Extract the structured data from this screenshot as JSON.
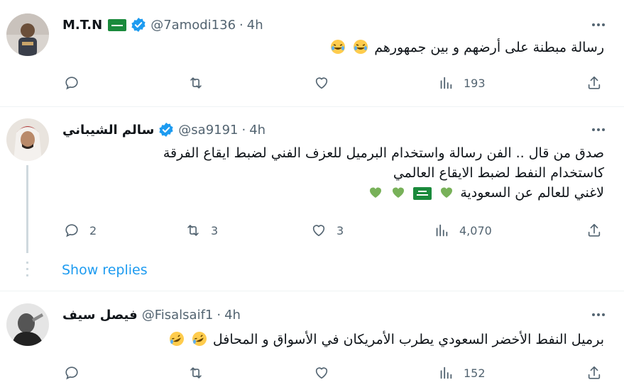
{
  "tweets": [
    {
      "name": "M.T.N",
      "handle": "@7amodi136",
      "separator": "·",
      "time": "4h",
      "lines": [
        "رسالة مبطنة على أرضهم و بين جمهورهم"
      ],
      "emoji": "laughing-crying",
      "counts": {
        "reply": "",
        "retweet": "",
        "like": "",
        "views": "193"
      }
    },
    {
      "name": "سالم الشيباني",
      "handle": "@sa9191",
      "separator": "·",
      "time": "4h",
      "lines": [
        "صدق من قال .. الفن رسالة واستخدام البرميل للعزف الفني لضبط ايقاع الفرقة",
        "كاستخدام النفط لضبط الايقاع العالمي",
        "لاغني للعالم عن السعودية"
      ],
      "counts": {
        "reply": "2",
        "retweet": "3",
        "like": "3",
        "views": "4,070"
      }
    },
    {
      "name": "فيصل سيف",
      "handle": "@Fisalsaif1",
      "separator": "·",
      "time": "4h",
      "lines": [
        "برميل النفط الأخضر السعودي يطرب الأمريكان في الأسواق و  المحافل"
      ],
      "emoji": "rolling-laughing",
      "counts": {
        "reply": "",
        "retweet": "",
        "like": "",
        "views": "152"
      }
    }
  ],
  "show_replies": "Show replies",
  "colors": {
    "accent": "#1d9bf0",
    "muted": "#536471",
    "flag": "#1a8a3c",
    "heart": "#78b159"
  }
}
